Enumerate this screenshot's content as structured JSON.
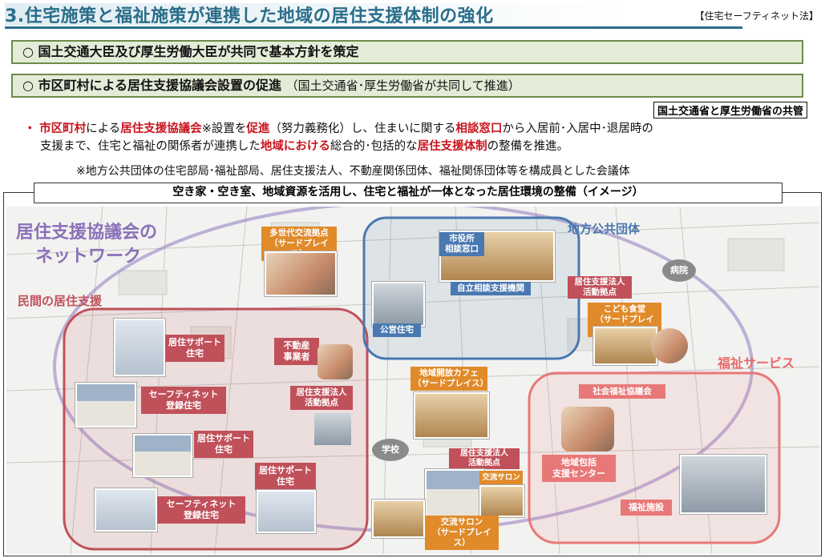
{
  "title": "3.住宅施策と福祉施策が連携した地域の居住支援体制の強化",
  "law_tag": "【住宅セーフティネット法】",
  "policy_1": "○ 国土交通大臣及び厚生労働大臣が共同で基本方針を策定",
  "policy_2_main": "○ 市区町村による居住支援協議会設置の促進",
  "policy_2_sub": "（国土交通省･厚生労働省が共同して推進）",
  "joint_tag": "国土交通省と厚生労働省の共管",
  "body": {
    "bullet": "・",
    "t1": "市区町村",
    "t2": "による",
    "t3": "居住支援協議会",
    "t4": "※設置を",
    "t5": "促進",
    "t6": "（努力義務化）し、住まいに関する",
    "t7": "相談窓口",
    "t8": "から入居前･入居中･退居時の",
    "t9": "支援まで、住宅と福祉の関係者が連携した",
    "t10": "地域における",
    "t11": "総合的･包括的な",
    "t12": "居住支援体制",
    "t13": "の整備を推進。"
  },
  "note": "※地方公共団体の住宅部局･福祉部局、居住支援法人、不動産関係団体、福祉関係団体等を構成員とした会議体",
  "image_heading": "空き家・空き室、地域資源を活用し、住宅と福祉が一体となった居住環境の整備（イメージ）",
  "map": {
    "network_title_1": "居住支援協議会の",
    "network_title_2": "ネットワーク",
    "private_support": "民間の居住支援",
    "local_gov": "地方公共団体",
    "welfare_services": "福祉サービス",
    "multi_gen_1": "多世代交流拠点",
    "multi_gen_2": "（サードプレイス）",
    "city_hall_1": "市役所",
    "city_hall_2": "相談窓口",
    "self_reliance": "自立相談支援機関",
    "public_housing": "公営住宅",
    "hospital": "病院",
    "corp_base_1a": "居住支援法人",
    "corp_base_1b": "活動拠点",
    "kids_cafeteria_1": "こども食堂",
    "kids_cafeteria_2": "（サードプレイス）",
    "support_house_1a": "居住サポート",
    "support_house_1b": "住宅",
    "realestate_1": "不動産",
    "realestate_2": "事業者",
    "safety_net_1a": "セーフティネット",
    "safety_net_1b": "登録住宅",
    "corp_base_2a": "居住支援法人",
    "corp_base_2b": "活動拠点",
    "community_cafe_1": "地域開放カフェ",
    "community_cafe_2": "（サードプレイス）",
    "social_welfare": "社会福祉協議会",
    "support_house_2a": "居住サポート",
    "support_house_2b": "住宅",
    "school": "学校",
    "support_house_3a": "居住サポート",
    "support_house_3b": "住宅",
    "corp_base_3a": "居住支援法人",
    "corp_base_3b": "活動拠点",
    "exchange_salon_small": "交流サロン",
    "comm_support_1": "地域包括",
    "comm_support_2": "支援センター",
    "safety_net_2a": "セーフティネット",
    "safety_net_2b": "登録住宅",
    "exchange_salon_1": "交流サロン",
    "exchange_salon_2": "（サードプレイス）",
    "welfare_facility": "福祉施設"
  },
  "colors": {
    "title": "#2a6e8a",
    "accent_red": "#c8141e",
    "policy_bg": "#e4ecd8",
    "private_zone": "#c0505a",
    "gov_zone": "#4a78b0",
    "welfare_zone": "#e87878",
    "network_purple": "#8a70b8",
    "third_place": "#e08a2a"
  }
}
